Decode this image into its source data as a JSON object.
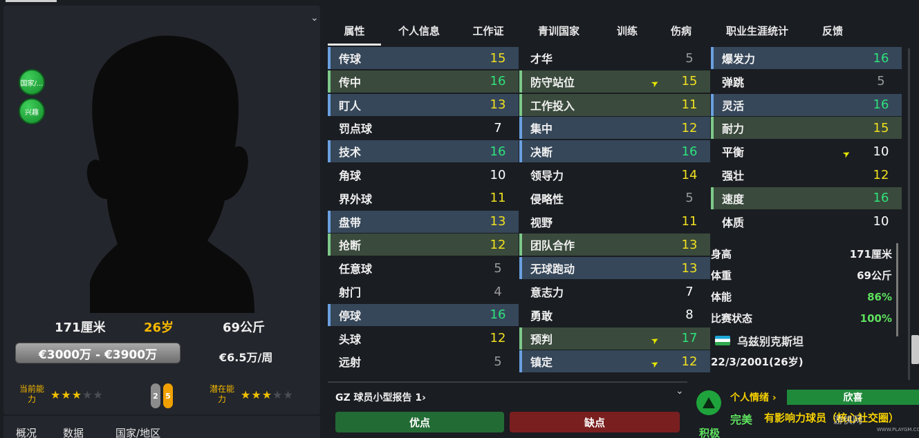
{
  "profile": {
    "badges": [
      "国家/...",
      "兴趣"
    ],
    "height": "171厘米",
    "age": "26岁",
    "weight": "69公斤",
    "value_range": "€3000万 - €3900万",
    "wage": "€6.5万/周",
    "current_ability_label": "当前能力",
    "potential_ability_label": "潜在能力",
    "current_stars": 3,
    "potential_stars": 3,
    "left_foot": "2",
    "right_foot": "5"
  },
  "bottom_tabs": [
    "概况",
    "数据",
    "国家/地区"
  ],
  "tabs": [
    "属性",
    "个人信息",
    "工作证",
    "青训国家",
    "训练",
    "伤病",
    "职业生涯统计",
    "反馈"
  ],
  "technical": [
    {
      "name": "传球",
      "value": "15",
      "color": "yellow",
      "hl": "blue"
    },
    {
      "name": "传中",
      "value": "16",
      "color": "green",
      "hl": "green"
    },
    {
      "name": "盯人",
      "value": "13",
      "color": "yellow",
      "hl": "blue"
    },
    {
      "name": "罚点球",
      "value": "7",
      "color": "white",
      "hl": "none"
    },
    {
      "name": "技术",
      "value": "16",
      "color": "green",
      "hl": "blue"
    },
    {
      "name": "角球",
      "value": "10",
      "color": "white",
      "hl": "none"
    },
    {
      "name": "界外球",
      "value": "11",
      "color": "yellow",
      "hl": "none"
    },
    {
      "name": "盘带",
      "value": "13",
      "color": "yellow",
      "hl": "blue"
    },
    {
      "name": "抢断",
      "value": "12",
      "color": "yellow",
      "hl": "green"
    },
    {
      "name": "任意球",
      "value": "5",
      "color": "grey",
      "hl": "none"
    },
    {
      "name": "射门",
      "value": "4",
      "color": "grey",
      "hl": "none"
    },
    {
      "name": "停球",
      "value": "16",
      "color": "green",
      "hl": "blue"
    },
    {
      "name": "头球",
      "value": "12",
      "color": "yellow",
      "hl": "none"
    },
    {
      "name": "远射",
      "value": "5",
      "color": "grey",
      "hl": "none"
    }
  ],
  "mental": [
    {
      "name": "才华",
      "value": "5",
      "color": "grey",
      "hl": "none",
      "arrow": false
    },
    {
      "name": "防守站位",
      "value": "15",
      "color": "yellow",
      "hl": "green",
      "arrow": true
    },
    {
      "name": "工作投入",
      "value": "11",
      "color": "yellow",
      "hl": "green",
      "arrow": false
    },
    {
      "name": "集中",
      "value": "12",
      "color": "yellow",
      "hl": "blue",
      "arrow": false
    },
    {
      "name": "决断",
      "value": "16",
      "color": "green",
      "hl": "blue",
      "arrow": false
    },
    {
      "name": "领导力",
      "value": "14",
      "color": "yellow",
      "hl": "none",
      "arrow": false
    },
    {
      "name": "侵略性",
      "value": "5",
      "color": "grey",
      "hl": "none",
      "arrow": false
    },
    {
      "name": "视野",
      "value": "11",
      "color": "yellow",
      "hl": "none",
      "arrow": false
    },
    {
      "name": "团队合作",
      "value": "13",
      "color": "yellow",
      "hl": "green",
      "arrow": false
    },
    {
      "name": "无球跑动",
      "value": "13",
      "color": "yellow",
      "hl": "blue",
      "arrow": false
    },
    {
      "name": "意志力",
      "value": "7",
      "color": "white",
      "hl": "none",
      "arrow": false
    },
    {
      "name": "勇敢",
      "value": "8",
      "color": "white",
      "hl": "none",
      "arrow": false
    },
    {
      "name": "预判",
      "value": "17",
      "color": "green",
      "hl": "green",
      "arrow": true
    },
    {
      "name": "镇定",
      "value": "12",
      "color": "yellow",
      "hl": "blue",
      "arrow": true
    }
  ],
  "physical": [
    {
      "name": "爆发力",
      "value": "16",
      "color": "green",
      "hl": "blue",
      "arrow": false
    },
    {
      "name": "弹跳",
      "value": "5",
      "color": "grey",
      "hl": "none",
      "arrow": false
    },
    {
      "name": "灵活",
      "value": "16",
      "color": "green",
      "hl": "blue",
      "arrow": false
    },
    {
      "name": "耐力",
      "value": "15",
      "color": "yellow",
      "hl": "green",
      "arrow": false
    },
    {
      "name": "平衡",
      "value": "10",
      "color": "white",
      "hl": "none",
      "arrow": true
    },
    {
      "name": "强壮",
      "value": "12",
      "color": "yellow",
      "hl": "none",
      "arrow": false
    },
    {
      "name": "速度",
      "value": "16",
      "color": "green",
      "hl": "green",
      "arrow": false
    },
    {
      "name": "体质",
      "value": "10",
      "color": "white",
      "hl": "none",
      "arrow": false
    }
  ],
  "info": [
    {
      "label": "身高",
      "value": "171厘米",
      "pct": false
    },
    {
      "label": "体重",
      "value": "69公斤",
      "pct": false
    },
    {
      "label": "体能",
      "value": "86%",
      "pct": true
    },
    {
      "label": "比赛状态",
      "value": "100%",
      "pct": true
    }
  ],
  "nationality": "乌兹别克斯坦",
  "dob": "22/3/2001(26岁)",
  "report": {
    "title": "GZ 球员小型报告 1",
    "pros": "优点",
    "cons": "缺点"
  },
  "mood": {
    "circle_label": "积极",
    "personal_title": "个人情绪",
    "happy": "欣喜",
    "perfect": "完美",
    "influence": "有影响力球员（核心社交圈）"
  },
  "watermark": {
    "text": "游侠网",
    "url": "WWW.PLAYGM.CC"
  },
  "colors": {
    "green": "#2ee27a",
    "yellow": "#f0e020",
    "white": "#ffffff",
    "grey": "#9a9a9a"
  }
}
